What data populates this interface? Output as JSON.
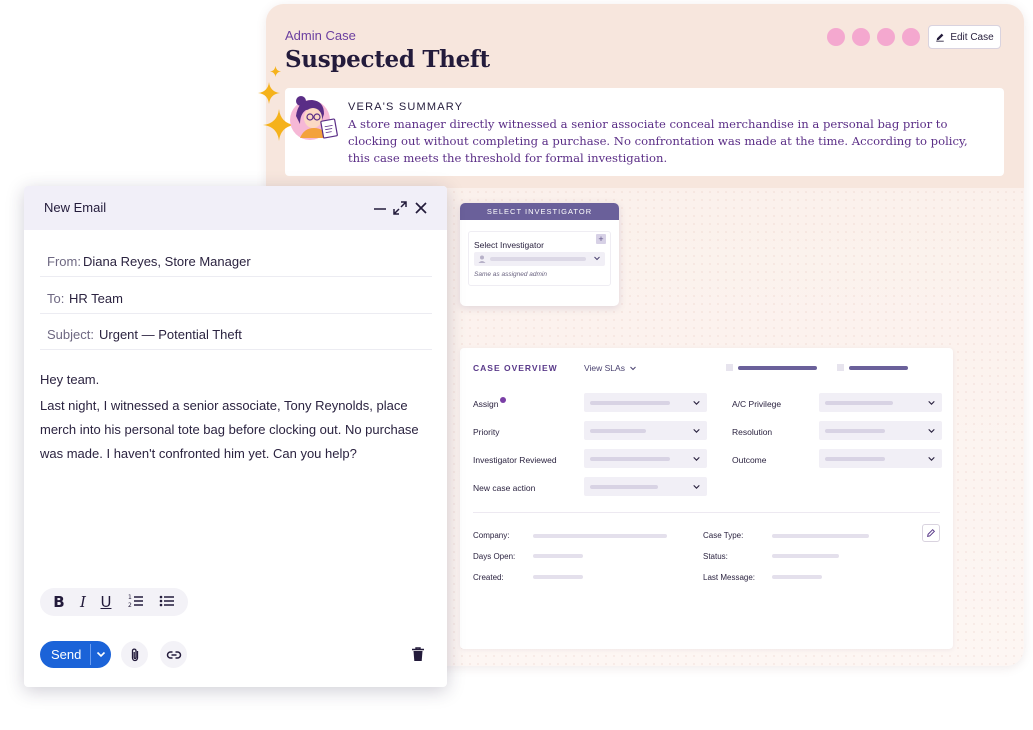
{
  "case": {
    "kicker": "Admin Case",
    "title": "Suspected Theft",
    "edit_label": "Edit Case",
    "summary_title": "VERA'S SUMMARY",
    "summary_text": "A store manager directly witnessed a senior associate conceal merchandise in a personal bag prior to clocking out without completing a purchase. No confrontation was made at the time. According to policy, this case meets the threshold for formal investigation."
  },
  "investigator": {
    "header": "SELECT INVESTIGATOR",
    "label": "Select Investigator",
    "note": "Same as assigned admin"
  },
  "overview": {
    "title": "CASE OVERVIEW",
    "view_slas": "View SLAs",
    "fields_left": [
      "Assign",
      "Priority",
      "Investigator Reviewed",
      "New case action"
    ],
    "fields_right": [
      "A/C Privilege",
      "Resolution",
      "Outcome"
    ],
    "meta_left": [
      "Company:",
      "Days Open:",
      "Created:"
    ],
    "meta_right": [
      "Case Type:",
      "Status:",
      "Last Message:"
    ]
  },
  "email": {
    "window_title": "New Email",
    "from_label": "From:",
    "from_value": "Diana Reyes, Store Manager",
    "to_label": "To:",
    "to_value": "HR Team",
    "subject_label": "Subject:",
    "subject_value": "Urgent — Potential Theft",
    "greeting": "Hey team.",
    "body": "Last night, I witnessed a senior associate, Tony Reynolds, place merch into his personal tote bag before clocking out. No purchase was made. I haven't confronted him yet. Can you help?",
    "send_label": "Send"
  },
  "colors": {
    "accent_purple": "#6b3fa0",
    "send_blue": "#1b63d8",
    "dot_pink": "#f4a8cf",
    "sparkle_gold": "#f5b21b"
  }
}
